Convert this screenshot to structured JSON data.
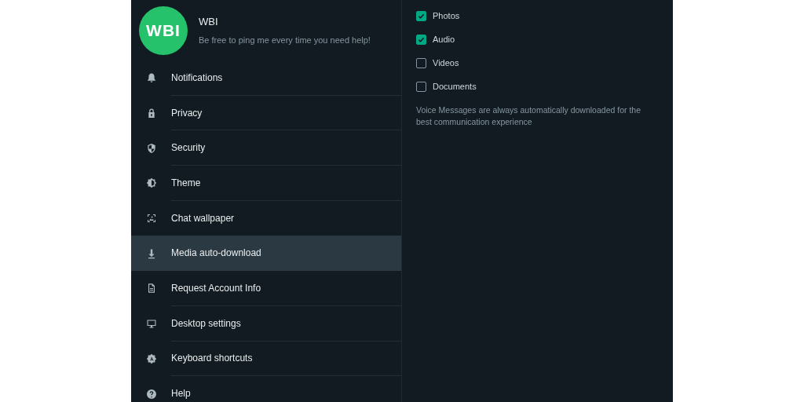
{
  "profile": {
    "logo": "WBI",
    "name": "WBI",
    "about": "Be free to ping me every time you need help!"
  },
  "menu": [
    {
      "label": "Notifications",
      "selected": false
    },
    {
      "label": "Privacy",
      "selected": false
    },
    {
      "label": "Security",
      "selected": false
    },
    {
      "label": "Theme",
      "selected": false
    },
    {
      "label": "Chat wallpaper",
      "selected": false
    },
    {
      "label": "Media auto-download",
      "selected": true
    },
    {
      "label": "Request Account Info",
      "selected": false
    },
    {
      "label": "Desktop settings",
      "selected": false
    },
    {
      "label": "Keyboard shortcuts",
      "selected": false
    },
    {
      "label": "Help",
      "selected": false
    }
  ],
  "media_options": [
    {
      "label": "Photos",
      "checked": true
    },
    {
      "label": "Audio",
      "checked": true
    },
    {
      "label": "Videos",
      "checked": false
    },
    {
      "label": "Documents",
      "checked": false
    }
  ],
  "note": "Voice Messages are always automatically downloaded for the best communication experience"
}
